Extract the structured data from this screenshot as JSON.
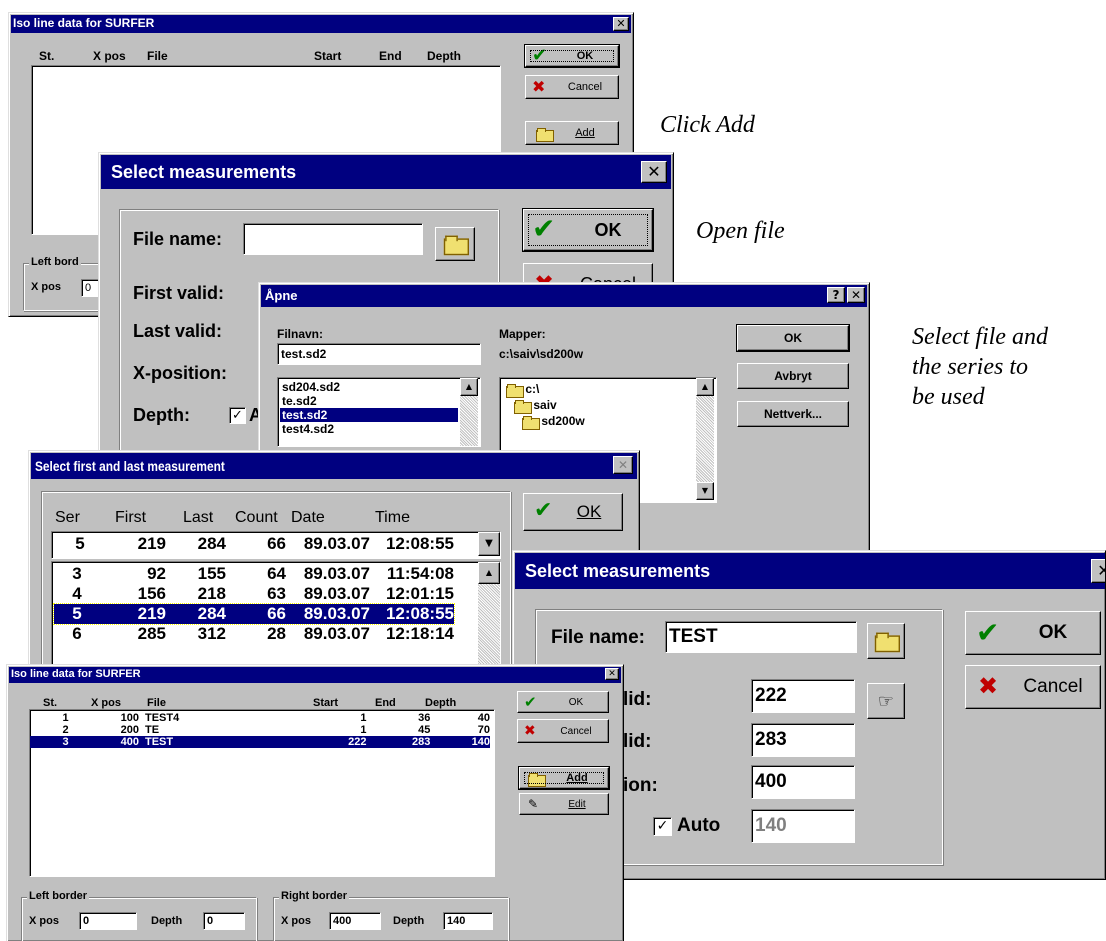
{
  "captions": {
    "click_add": "Click Add",
    "open_file": "Open file",
    "select_file_lines": [
      "Select file and",
      "the series to",
      "be used"
    ]
  },
  "iso1": {
    "title": "Iso line data for SURFER",
    "columns": [
      "St.",
      "X pos",
      "File",
      "Start",
      "End",
      "Depth"
    ],
    "ok": "OK",
    "cancel": "Cancel",
    "add": "Add",
    "left_border": "Left bord",
    "xpos_label": "X pos",
    "xpos_value": "0"
  },
  "sel1": {
    "title": "Select measurements",
    "file_name_label": "File name:",
    "file_name_value": "",
    "first_valid_label": "First valid:",
    "last_valid_label": "Last valid:",
    "x_position_label": "X-position:",
    "depth_label": "Depth:",
    "auto_label": "A",
    "ok": "OK",
    "cancel": "Cancel"
  },
  "apne": {
    "title": "Åpne",
    "help": "?",
    "filnavn_label": "Filnavn:",
    "filnavn_value": "test.sd2",
    "mapper_label": "Mapper:",
    "mapper_path": "c:\\saiv\\sd200w",
    "files": [
      "sd204.sd2",
      "te.sd2",
      "test.sd2",
      "test4.sd2"
    ],
    "selected_file_index": 2,
    "folders": [
      "c:\\",
      "saiv",
      "sd200w"
    ],
    "ok": "OK",
    "avbryt": "Avbryt",
    "nettverk": "Nettverk..."
  },
  "firstlast": {
    "title": "Select first and last measurement",
    "columns": [
      "Ser",
      "First",
      "Last",
      "Count",
      "Date",
      "Time"
    ],
    "current": [
      "5",
      "219",
      "284",
      "66",
      "89.03.07",
      "12:08:55"
    ],
    "rows": [
      [
        "3",
        "92",
        "155",
        "64",
        "89.03.07",
        "11:54:08"
      ],
      [
        "4",
        "156",
        "218",
        "63",
        "89.03.07",
        "12:01:15"
      ],
      [
        "5",
        "219",
        "284",
        "66",
        "89.03.07",
        "12:08:55"
      ],
      [
        "6",
        "285",
        "312",
        "28",
        "89.03.07",
        "12:18:14"
      ]
    ],
    "selected_row_index": 2,
    "ok": "OK"
  },
  "sel2": {
    "title": "Select measurements",
    "file_name_label": "File name:",
    "file_name_value": "TEST",
    "first_valid_label": "lid:",
    "first_valid_value": "222",
    "last_valid_label": "lid:",
    "last_valid_value": "283",
    "x_position_label": "ion:",
    "x_position_value": "400",
    "auto_label": "Auto",
    "depth_value": "140",
    "ok": "OK",
    "cancel": "Cancel"
  },
  "iso2": {
    "title": "Iso line data for SURFER",
    "columns": [
      "St.",
      "X pos",
      "File",
      "Start",
      "End",
      "Depth"
    ],
    "rows": [
      [
        "1",
        "100",
        "TEST4",
        "1",
        "36",
        "40"
      ],
      [
        "2",
        "200",
        "TE",
        "1",
        "45",
        "70"
      ],
      [
        "3",
        "400",
        "TEST",
        "222",
        "283",
        "140"
      ]
    ],
    "selected_row_index": 2,
    "ok": "OK",
    "cancel": "Cancel",
    "add": "Add",
    "edit": "Edit",
    "left_border": "Left border",
    "right_border": "Right border",
    "xpos_label": "X pos",
    "depth_label": "Depth",
    "left_xpos": "0",
    "left_depth": "0",
    "right_xpos": "400",
    "right_depth": "140"
  }
}
